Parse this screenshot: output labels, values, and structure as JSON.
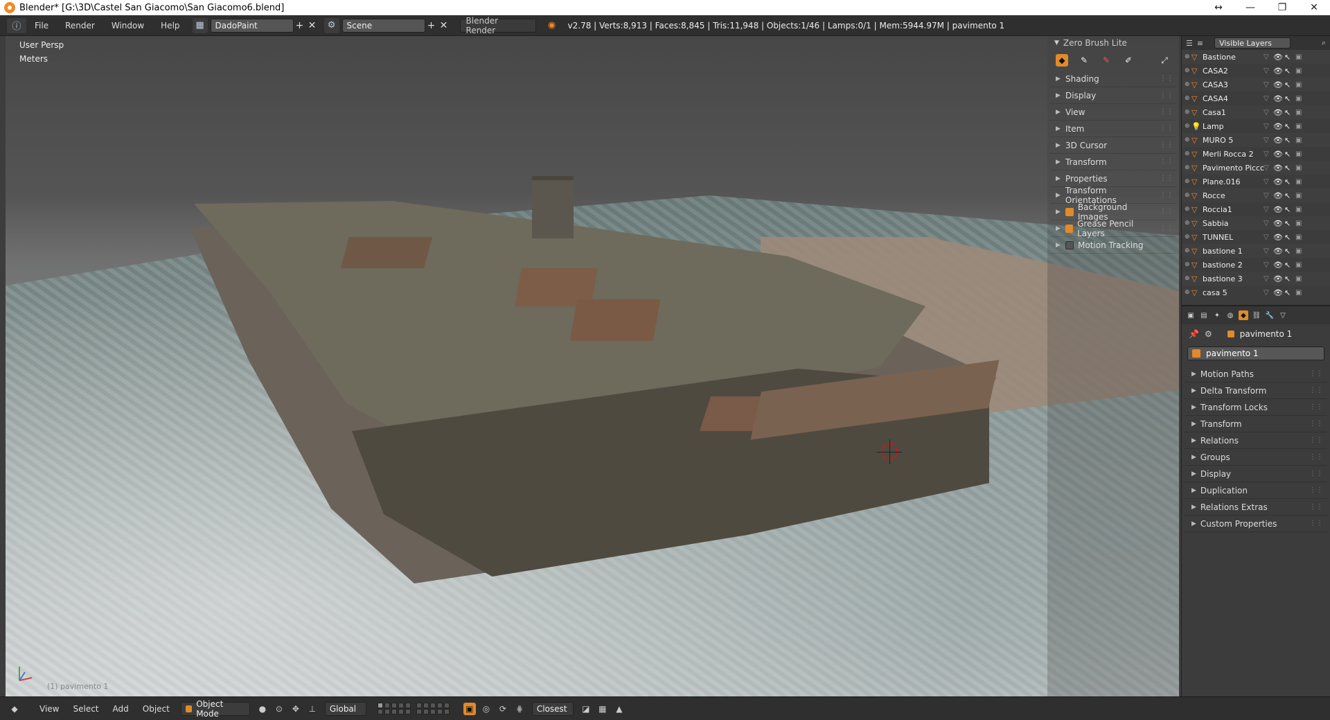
{
  "window": {
    "title": "Blender* [G:\\3D\\Castel San Giacomo\\San Giacomo6.blend]",
    "controls": [
      "↔",
      "—",
      "❐",
      "✕"
    ]
  },
  "header": {
    "menus": [
      "File",
      "Render",
      "Window",
      "Help"
    ],
    "screen_layout": "DadoPaint",
    "scene": "Scene",
    "render_engine": "Blender Render",
    "stats": "v2.78 | Verts:8,913 | Faces:8,845 | Tris:11,948 | Objects:1/46 | Lamps:0/1 | Mem:5944.97M | pavimento 1"
  },
  "viewport": {
    "view_name": "User Persp",
    "units": "Meters",
    "active_object_label": "(1) pavimento 1"
  },
  "tool_panel": {
    "title": "Zero Brush Lite",
    "panels": [
      {
        "label": "Shading",
        "checkbox": null
      },
      {
        "label": "Display",
        "checkbox": null
      },
      {
        "label": "View",
        "checkbox": null
      },
      {
        "label": "Item",
        "checkbox": null
      },
      {
        "label": "3D Cursor",
        "checkbox": null
      },
      {
        "label": "Transform",
        "checkbox": null
      },
      {
        "label": "Properties",
        "checkbox": null
      },
      {
        "label": "Transform Orientations",
        "checkbox": null
      },
      {
        "label": "Background Images",
        "checkbox": true
      },
      {
        "label": "Grease Pencil Layers",
        "checkbox": true
      },
      {
        "label": "Motion Tracking",
        "checkbox": false
      }
    ]
  },
  "outliner": {
    "filter": "Visible Layers",
    "items": [
      {
        "name": "Bastione",
        "type": "mesh"
      },
      {
        "name": "CASA2",
        "type": "mesh"
      },
      {
        "name": "CASA3",
        "type": "mesh"
      },
      {
        "name": "CASA4",
        "type": "mesh"
      },
      {
        "name": "Casa1",
        "type": "mesh"
      },
      {
        "name": "Lamp",
        "type": "lamp"
      },
      {
        "name": "MURO 5",
        "type": "mesh"
      },
      {
        "name": "Merli Rocca 2",
        "type": "mesh"
      },
      {
        "name": "Pavimento Piccolo",
        "type": "mesh"
      },
      {
        "name": "Plane.016",
        "type": "mesh"
      },
      {
        "name": "Rocce",
        "type": "mesh"
      },
      {
        "name": "Roccia1",
        "type": "mesh"
      },
      {
        "name": "Sabbia",
        "type": "mesh"
      },
      {
        "name": "TUNNEL",
        "type": "mesh"
      },
      {
        "name": "bastione 1",
        "type": "mesh"
      },
      {
        "name": "bastione 2",
        "type": "mesh"
      },
      {
        "name": "bastione 3",
        "type": "mesh"
      },
      {
        "name": "casa 5",
        "type": "mesh"
      }
    ]
  },
  "properties": {
    "context_object": "pavimento 1",
    "object_name": "pavimento 1",
    "panels": [
      "Motion Paths",
      "Delta Transform",
      "Transform Locks",
      "Transform",
      "Relations",
      "Groups",
      "Display",
      "Duplication",
      "Relations Extras",
      "Custom Properties"
    ]
  },
  "bottom": {
    "menus": [
      "View",
      "Select",
      "Add",
      "Object"
    ],
    "mode": "Object Mode",
    "orientation": "Global",
    "snap_target": "Closest"
  },
  "colors": {
    "accent": "#e08a2b",
    "panel_bg": "#3c3c3c",
    "header_bg": "#2f2f2f"
  }
}
